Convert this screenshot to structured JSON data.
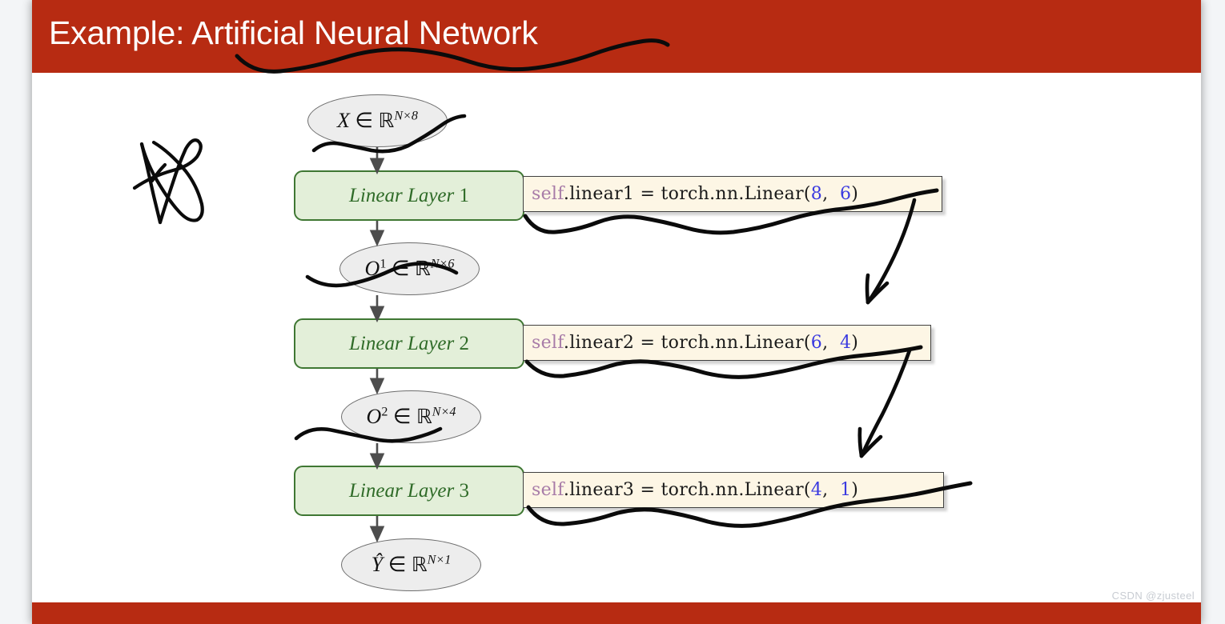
{
  "slide": {
    "title": "Example: Artificial Neural Network",
    "watermark": "CSDN @zjusteel",
    "colors": {
      "title_band": "#b72b12",
      "bottom_band": "#b72b12",
      "slide_bg": "#ffffff",
      "page_bg": "#f3f5f7",
      "ellipse_fill": "#ededed",
      "ellipse_border": "#6d6d6d",
      "layer_box_fill": "#e3efd9",
      "layer_box_border": "#3f7733",
      "layer_box_text": "#2f6b28",
      "code_box_fill": "#fdf6e5",
      "code_box_border": "#404040",
      "code_keyword": "#a87ca8",
      "code_number": "#3a3ae0",
      "arrow": "#4d4d4d",
      "ink": "#000000",
      "watermark": "#c8ccd2"
    }
  },
  "flow": {
    "nodes": [
      {
        "kind": "tensor",
        "name": "input-tensor",
        "symbol": "X",
        "super": "",
        "space": "ℝ",
        "shape": "N×8"
      },
      {
        "kind": "layer",
        "name": "linear-layer-1",
        "label_italic": "Linear Layer",
        "label_index": "1"
      },
      {
        "kind": "tensor",
        "name": "hidden-tensor-1",
        "symbol": "O",
        "super": "1",
        "space": "ℝ",
        "shape": "N×6"
      },
      {
        "kind": "layer",
        "name": "linear-layer-2",
        "label_italic": "Linear Layer",
        "label_index": "2"
      },
      {
        "kind": "tensor",
        "name": "hidden-tensor-2",
        "symbol": "O",
        "super": "2",
        "space": "ℝ",
        "shape": "N×4"
      },
      {
        "kind": "layer",
        "name": "linear-layer-3",
        "label_italic": "Linear Layer",
        "label_index": "3"
      },
      {
        "kind": "tensor",
        "name": "output-tensor",
        "symbol": "Ŷ",
        "super": "",
        "space": "ℝ",
        "shape": "N×1"
      }
    ],
    "membership_symbol": "∈"
  },
  "code_snippets": [
    {
      "name": "code-linear1",
      "keyword": "self",
      "middle": ".linear1 = torch.nn.Linear(",
      "arg_in": "8",
      "separator": ",  ",
      "arg_out": "6",
      "close": ")",
      "full_text": "self.linear1 = torch.nn.Linear(8,  6)"
    },
    {
      "name": "code-linear2",
      "keyword": "self",
      "middle": ".linear2 = torch.nn.Linear(",
      "arg_in": "6",
      "separator": ",  ",
      "arg_out": "4",
      "close": ")",
      "full_text": "self.linear2 = torch.nn.Linear(6,  4)"
    },
    {
      "name": "code-linear3",
      "keyword": "self",
      "middle": ".linear3 = torch.nn.Linear(",
      "arg_in": "4",
      "separator": ",  ",
      "arg_out": "1",
      "close": ")",
      "full_text": "self.linear3 = torch.nn.Linear(4,  1)"
    }
  ],
  "annotations": {
    "star_scribble": "hand-drawn-star",
    "underline_title": "hand-drawn-squiggle-under-title",
    "underline_code1": "hand-drawn-squiggle-under-code1",
    "underline_code2": "hand-drawn-squiggle-under-code2",
    "underline_code3": "hand-drawn-squiggle-under-code3",
    "squiggle_tensor_x": "hand-drawn-squiggle-through-x",
    "squiggle_tensor_o1": "hand-drawn-squiggle-through-o1",
    "squiggle_tensor_o2": "hand-drawn-squiggle-through-o2",
    "arrow_code1_to_code2": "hand-drawn-arrow-down-left",
    "arrow_code2_to_code3": "hand-drawn-arrow-down-left"
  }
}
